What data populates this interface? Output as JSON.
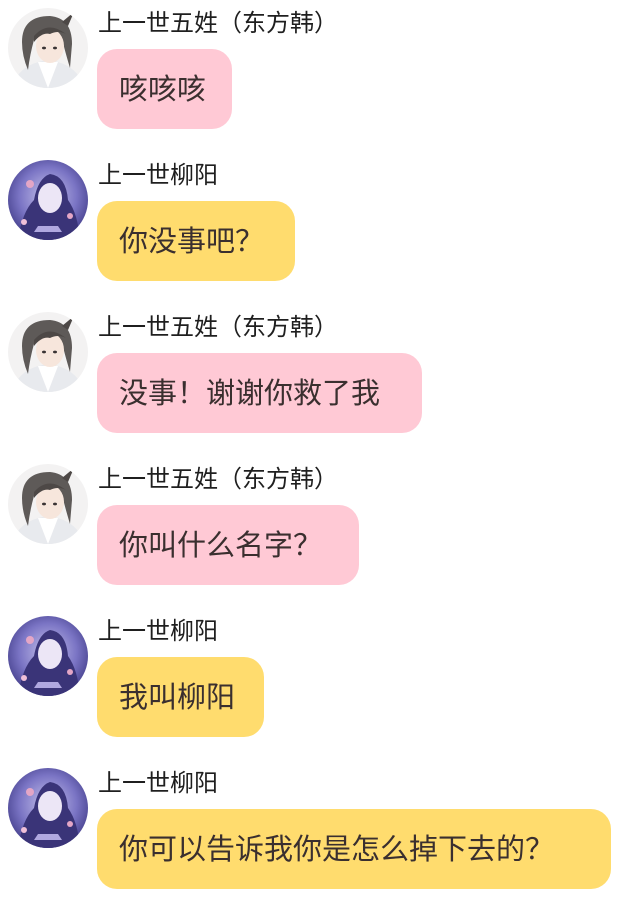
{
  "colors": {
    "pink_bubble": "#ffc9d5",
    "yellow_bubble": "#ffdc6e",
    "background": "#ffffff"
  },
  "messages": [
    {
      "sender": "上一世五姓（东方韩）",
      "text": "咳咳咳",
      "avatar": "male-character-avatar",
      "bubble": "pink"
    },
    {
      "sender": "上一世柳阳",
      "text": "你没事吧？",
      "avatar": "female-character-avatar",
      "bubble": "yellow"
    },
    {
      "sender": "上一世五姓（东方韩）",
      "text": "没事！谢谢你救了我",
      "avatar": "male-character-avatar",
      "bubble": "pink"
    },
    {
      "sender": "上一世五姓（东方韩）",
      "text": "你叫什么名字？",
      "avatar": "male-character-avatar",
      "bubble": "pink"
    },
    {
      "sender": "上一世柳阳",
      "text": "我叫柳阳",
      "avatar": "female-character-avatar",
      "bubble": "yellow"
    },
    {
      "sender": "上一世柳阳",
      "text": "你可以告诉我你是怎么掉下去的？",
      "avatar": "female-character-avatar",
      "bubble": "yellow"
    }
  ]
}
